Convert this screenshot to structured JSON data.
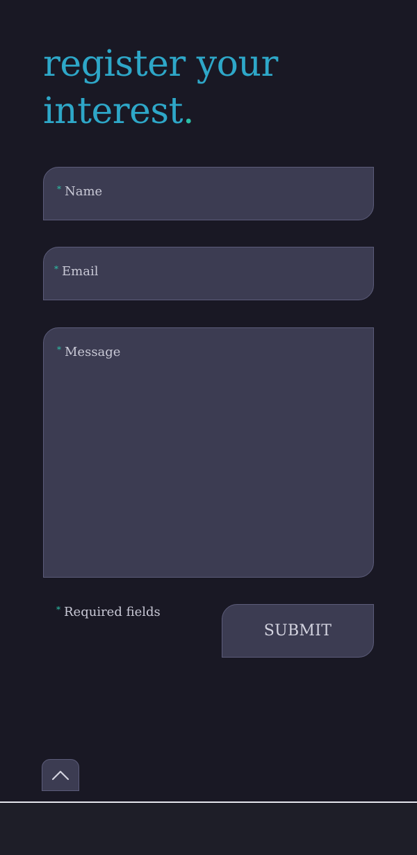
{
  "heading": {
    "line1": "register your",
    "line2": "interest",
    "dot": "."
  },
  "form": {
    "required_marker": "*",
    "name_placeholder": "Name",
    "email_placeholder": "Email",
    "message_placeholder": "Message",
    "required_note": "Required fields",
    "submit_label": "SUBMIT"
  },
  "icons": {
    "back_to_top": "chevron-up-icon"
  },
  "colors": {
    "accent_heading": "#2ea7c8",
    "accent_marker": "#2bc0a7",
    "background": "#191824",
    "field_background": "#3c3c52"
  }
}
